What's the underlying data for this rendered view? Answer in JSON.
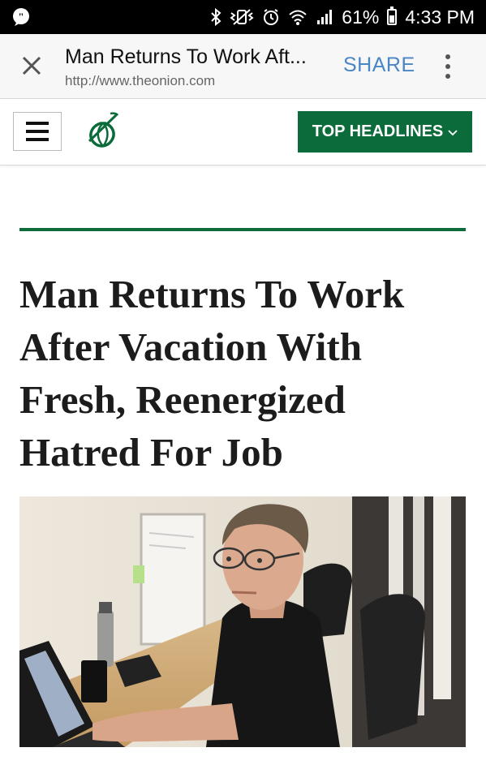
{
  "status_bar": {
    "battery_percent": "61%",
    "time": "4:33 PM"
  },
  "custom_tab": {
    "title": "Man Returns To Work Aft...",
    "url": "http://www.theonion.com",
    "share_label": "SHARE"
  },
  "site_nav": {
    "headlines_label": "TOP HEADLINES"
  },
  "article": {
    "headline_lines": [
      "Man Returns To Work",
      "After Vacation With",
      "Fresh, Reenergized",
      "Hatred For Job"
    ]
  },
  "colors": {
    "brand_green": "#0c6b3b",
    "share_blue": "#4a86c5"
  }
}
